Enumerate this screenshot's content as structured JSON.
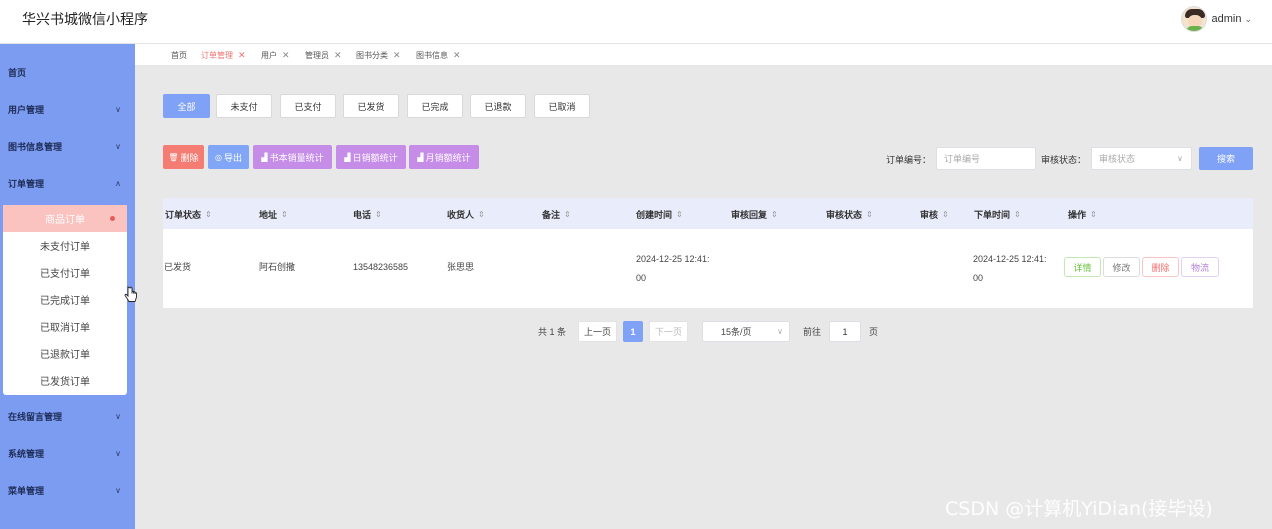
{
  "app": {
    "title": "华兴书城微信小程序"
  },
  "user": {
    "name": "admin"
  },
  "sidebar": {
    "items": [
      {
        "label": "首页"
      },
      {
        "label": "用户管理"
      },
      {
        "label": "图书信息管理"
      },
      {
        "label": "订单管理"
      },
      {
        "label": "在线留言管理"
      },
      {
        "label": "系统管理"
      },
      {
        "label": "菜单管理"
      }
    ],
    "order_sub": [
      {
        "label": "商品订单"
      },
      {
        "label": "未支付订单"
      },
      {
        "label": "已支付订单"
      },
      {
        "label": "已完成订单"
      },
      {
        "label": "已取消订单"
      },
      {
        "label": "已退款订单"
      },
      {
        "label": "已发货订单"
      }
    ]
  },
  "tabs": [
    {
      "label": "首页"
    },
    {
      "label": "订单管理"
    },
    {
      "label": "用户"
    },
    {
      "label": "管理员"
    },
    {
      "label": "图书分类"
    },
    {
      "label": "图书信息"
    }
  ],
  "status_filters": [
    "全部",
    "未支付",
    "已支付",
    "已发货",
    "已完成",
    "已退款",
    "已取消"
  ],
  "actions": {
    "delete": "删除",
    "export": "导出",
    "book_stats": "书本销量统计",
    "daily_stats": "日销额统计",
    "monthly_stats": "月销额统计"
  },
  "search": {
    "order_no_label": "订单编号：",
    "order_no_placeholder": "订单编号",
    "audit_label": "审核状态：",
    "audit_placeholder": "审核状态",
    "button": "搜索"
  },
  "table": {
    "headers": [
      "订单状态",
      "地址",
      "电话",
      "收货人",
      "备注",
      "创建时间",
      "审核回复",
      "审核状态",
      "审核",
      "下单时间",
      "操作"
    ],
    "rows": [
      {
        "status": "已发货",
        "address": "阿石创撒",
        "phone": "13548236585",
        "receiver": "张思思",
        "remark": "",
        "created_line1": "2024-12-25 12:41:",
        "created_line2": "00",
        "audit_reply": "",
        "audit_status": "",
        "audit": "",
        "ordered_line1": "2024-12-25 12:41:",
        "ordered_line2": "00"
      }
    ],
    "row_actions": [
      "详情",
      "修改",
      "删除",
      "物流"
    ]
  },
  "pagination": {
    "total": "共 1 条",
    "prev": "上一页",
    "current": "1",
    "next": "下一页",
    "page_size": "15条/页",
    "goto_label": "前往",
    "goto_value": "1",
    "page_suffix": "页"
  },
  "watermark": "CSDN @计算机YiDian(接毕设)",
  "colors": {
    "sidebar": "#7c9cf1",
    "primary": "#7fa2f7",
    "danger": "#f47c73",
    "export": "#81a6f7",
    "stats": "#c58ce8",
    "active_sub": "#fbc3c0"
  }
}
